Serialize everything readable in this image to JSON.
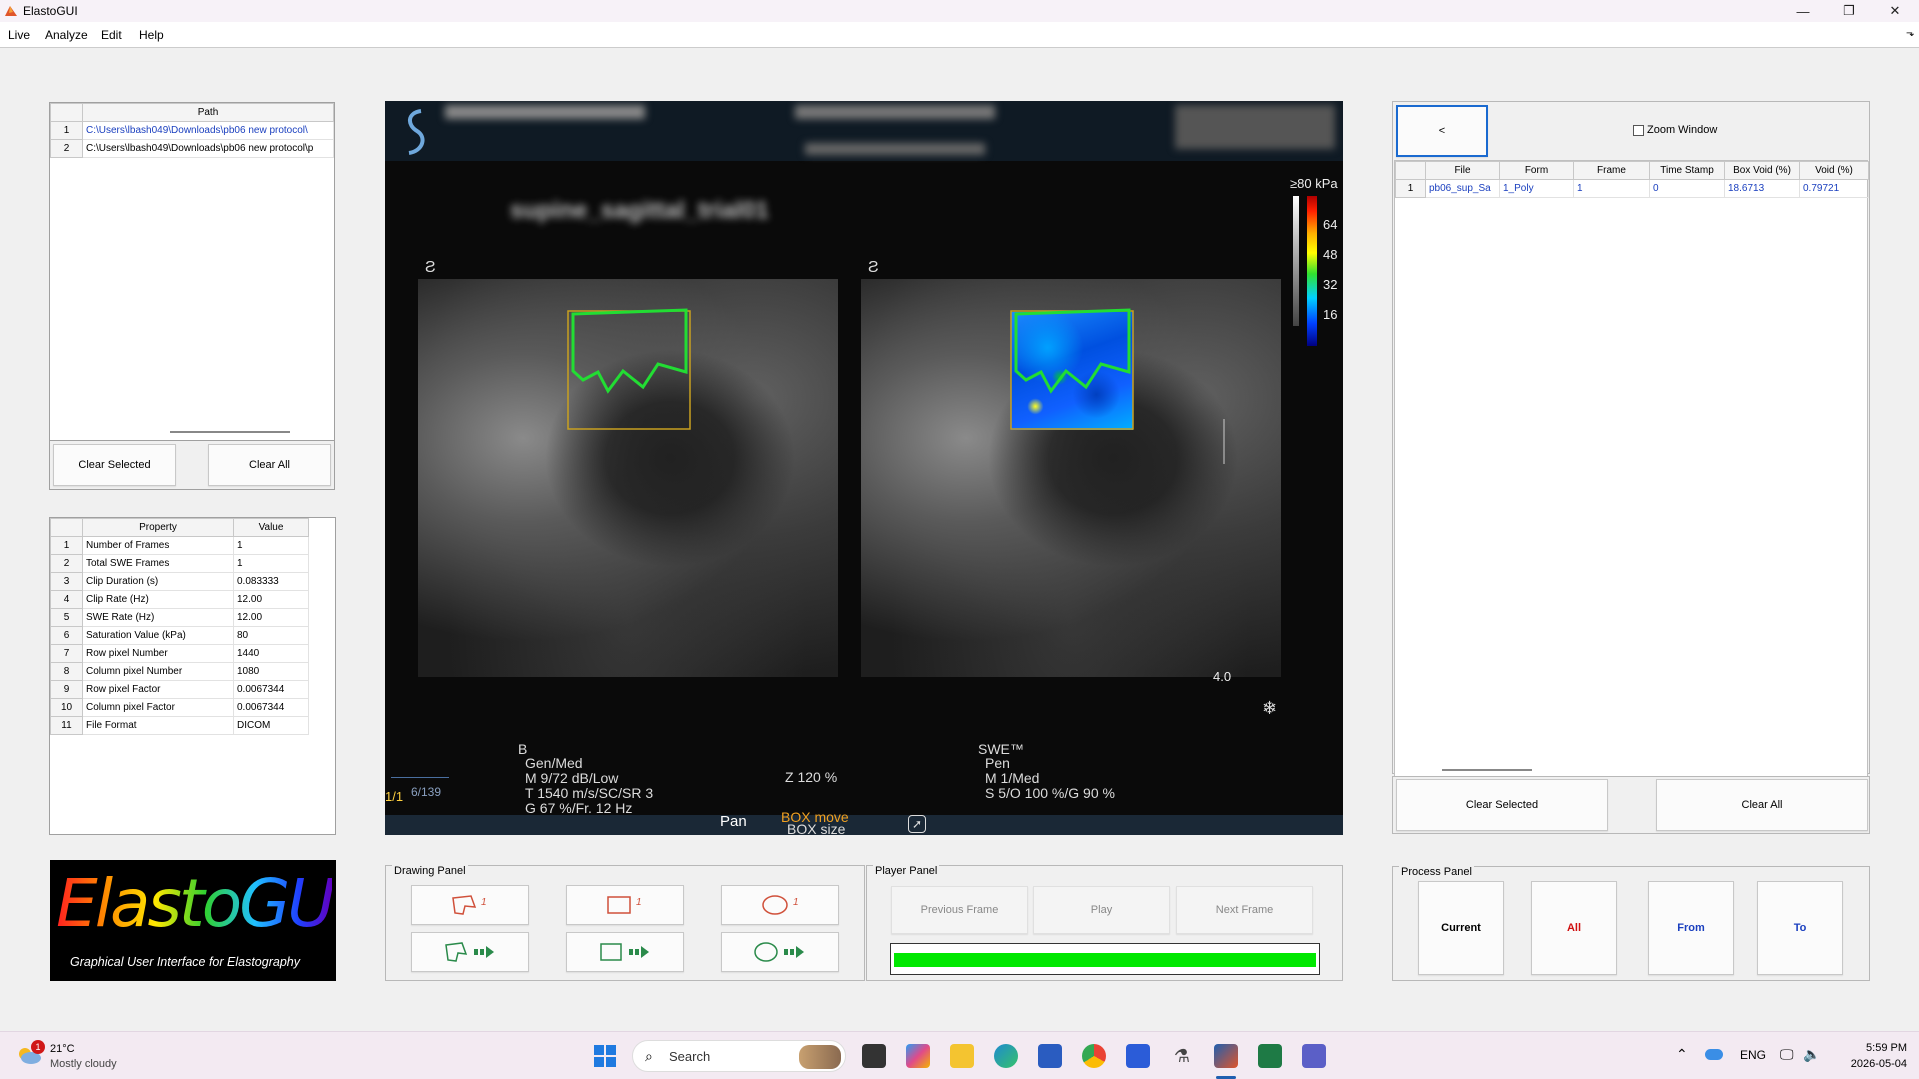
{
  "window": {
    "title": "ElastoGUI"
  },
  "menu": [
    "Live",
    "Analyze",
    "Edit",
    "Help"
  ],
  "path_table": {
    "header": "Path",
    "rows": [
      "C:\\Users\\lbash049\\Downloads\\pb06 new protocol\\",
      "C:\\Users\\lbash049\\Downloads\\pb06 new protocol\\p"
    ],
    "clear_selected": "Clear Selected",
    "clear_all": "Clear All"
  },
  "property_table": {
    "headers": [
      "Property",
      "Value"
    ],
    "rows": [
      [
        "Number of Frames",
        "1"
      ],
      [
        "Total SWE Frames",
        "1"
      ],
      [
        "Clip Duration (s)",
        "0.083333"
      ],
      [
        "Clip Rate (Hz)",
        "12.00"
      ],
      [
        "SWE Rate (Hz)",
        "12.00"
      ],
      [
        "Saturation Value (kPa)",
        "80"
      ],
      [
        "Row pixel Number",
        "1440"
      ],
      [
        "Column pixel Number",
        "1080"
      ],
      [
        "Row pixel Factor",
        "0.0067344"
      ],
      [
        "Column pixel Factor",
        "0.0067344"
      ],
      [
        "File Format",
        "DICOM"
      ]
    ]
  },
  "logo": {
    "title": "ElastoGUI",
    "subtitle": "Graphical User Interface for Elastography"
  },
  "viewer": {
    "blurred_name": "supine_sagittal_trial01",
    "scale_max": "≥80 kPa",
    "scale_ticks": [
      "64",
      "48",
      "32",
      "16"
    ],
    "depth_label": "4.0",
    "left_mode": "B",
    "left_params": [
      "Gen/Med",
      "M 9/72 dB/Low",
      "T 1540 m/s/SC/SR 3",
      "G 67 %/Fr. 12 Hz"
    ],
    "zoom": "Z 120 %",
    "right_mode": "SWE™",
    "right_params": [
      "Pen",
      "M 1/Med",
      "S 5/O 100 %/G 90 %"
    ],
    "frame_counter": "1/1",
    "frame_total": "6/139",
    "pan": "Pan",
    "box_move": "BOX move",
    "box_size": "BOX size"
  },
  "right_panel": {
    "collapse_button": "<",
    "zoom_window": "Zoom Window",
    "headers": [
      "File",
      "Form",
      "Frame",
      "Time Stamp",
      "Box Void (%)",
      "Void (%)"
    ],
    "rows": [
      [
        "pb06_sup_Sa",
        "1_Poly",
        "1",
        "0",
        "18.6713",
        "0.79721"
      ]
    ],
    "clear_selected": "Clear Selected",
    "clear_all": "Clear All"
  },
  "drawing_panel": {
    "title": "Drawing Panel"
  },
  "player_panel": {
    "title": "Player Panel",
    "previous": "Previous Frame",
    "play": "Play",
    "next": "Next Frame",
    "progress": 1.0
  },
  "process_panel": {
    "title": "Process Panel",
    "current": "Current",
    "all": "All",
    "from": "From",
    "to": "To"
  },
  "taskbar": {
    "weather_temp": "21°C",
    "weather_desc": "Mostly cloudy",
    "weather_badge": "1",
    "search": "Search",
    "lang": "ENG",
    "time": "5:59 PM",
    "date": "2026-05-04"
  },
  "colors": {
    "accent_blue": "#1a3fbf",
    "all_red": "#d01010",
    "roi_green": "#22dd33",
    "progress_green": "#00e800"
  }
}
